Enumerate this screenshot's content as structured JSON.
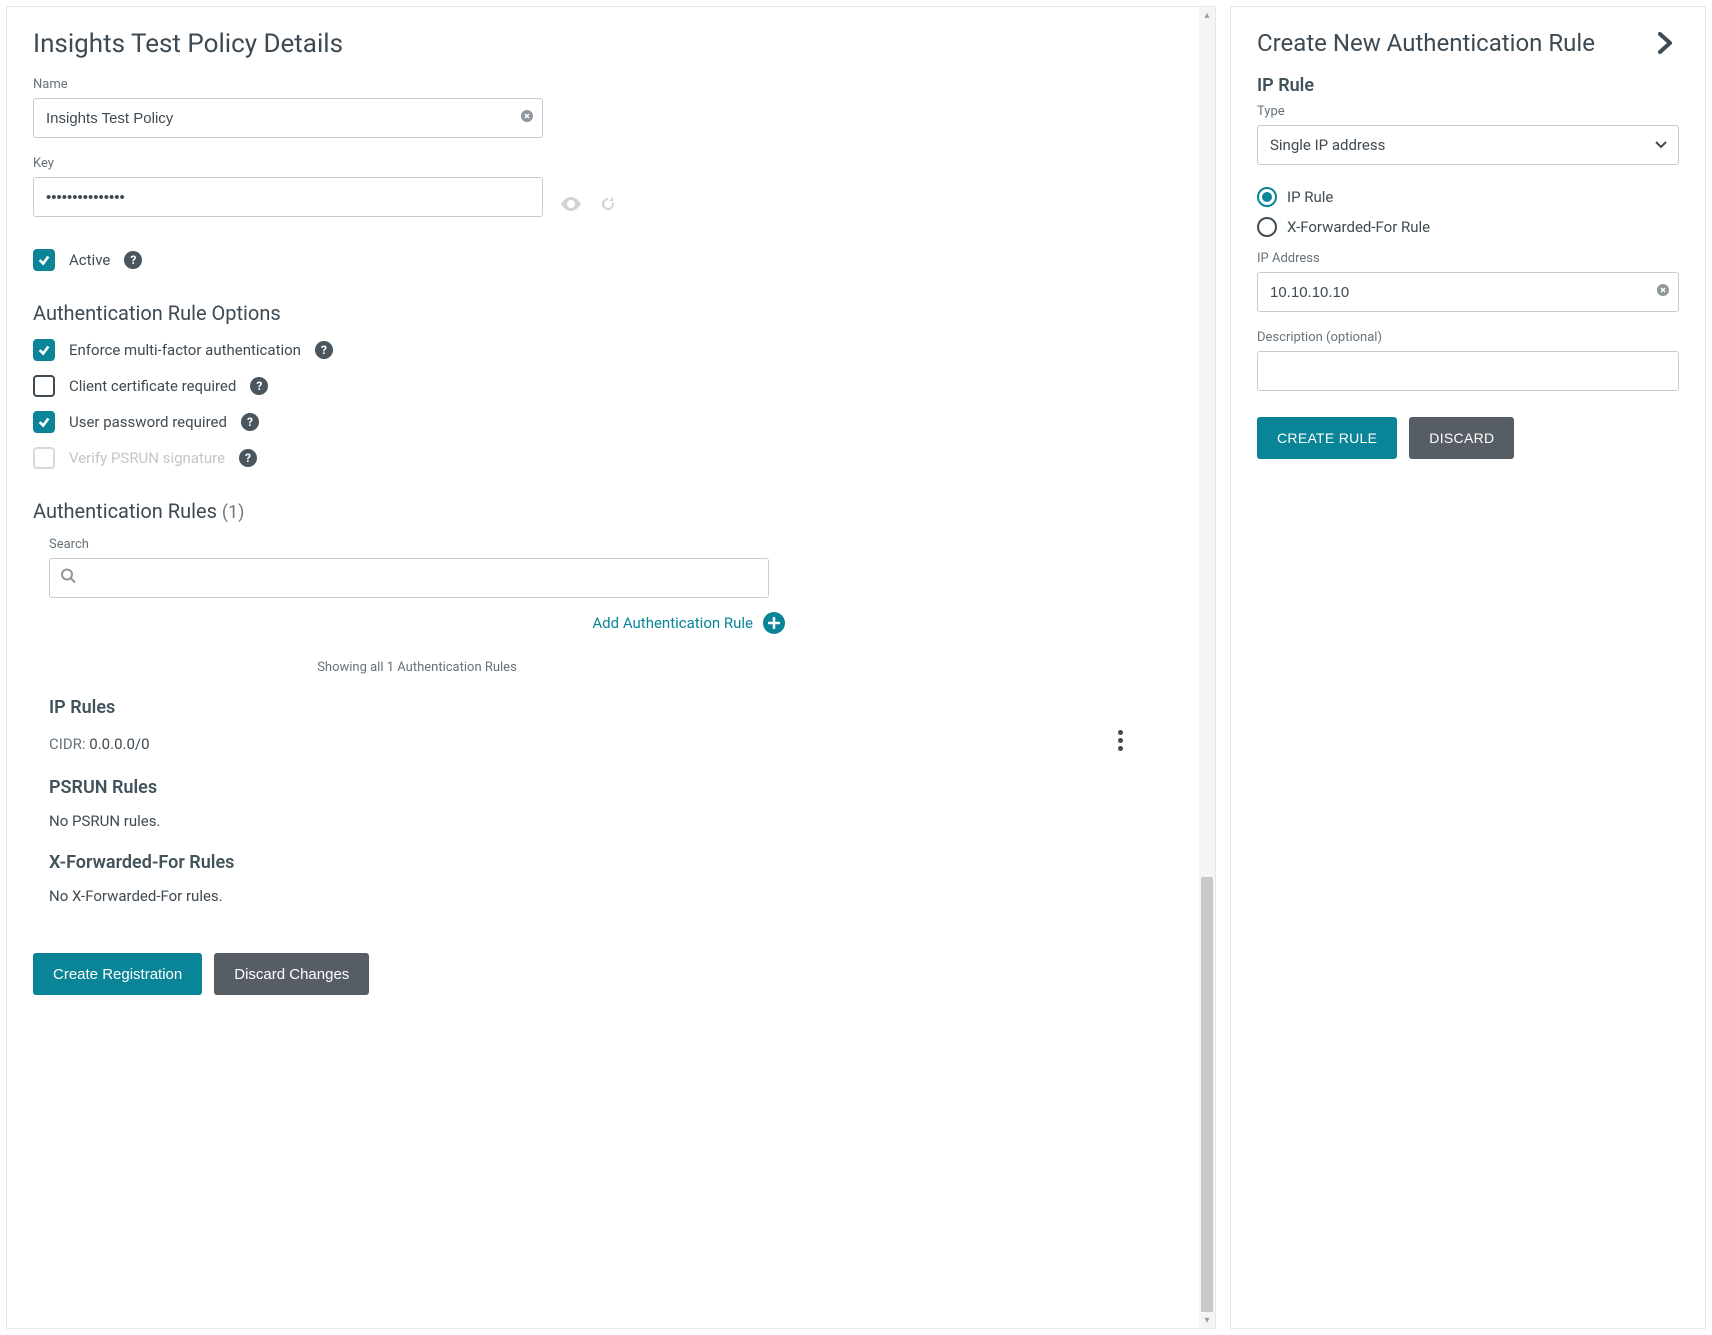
{
  "leftPanel": {
    "title": "Insights Test Policy Details",
    "name": {
      "label": "Name",
      "value": "Insights Test Policy"
    },
    "key": {
      "label": "Key",
      "value": "•••••••••••••••"
    },
    "active": {
      "label": "Active",
      "checked": true
    },
    "authOptions": {
      "title": "Authentication Rule Options",
      "items": [
        {
          "label": "Enforce multi-factor authentication",
          "checked": true,
          "disabled": false
        },
        {
          "label": "Client certificate required",
          "checked": false,
          "disabled": false
        },
        {
          "label": "User password required",
          "checked": true,
          "disabled": false
        },
        {
          "label": "Verify PSRUN signature",
          "checked": false,
          "disabled": true
        }
      ]
    },
    "authRules": {
      "title": "Authentication Rules",
      "count": "(1)",
      "searchLabel": "Search",
      "searchValue": "",
      "addLink": "Add Authentication Rule",
      "showingText": "Showing all 1 Authentication Rules",
      "ipRules": {
        "title": "IP Rules",
        "cidrLabel": "CIDR:",
        "cidrValue": "0.0.0.0/0"
      },
      "psrunRules": {
        "title": "PSRUN Rules",
        "emptyText": "No PSRUN rules."
      },
      "xffRules": {
        "title": "X-Forwarded-For Rules",
        "emptyText": "No X-Forwarded-For rules."
      }
    },
    "buttons": {
      "create": "Create Registration",
      "discard": "Discard Changes"
    }
  },
  "rightPanel": {
    "title": "Create New Authentication Rule",
    "subtitle": "IP Rule",
    "type": {
      "label": "Type",
      "value": "Single IP address"
    },
    "radios": [
      {
        "label": "IP Rule",
        "selected": true
      },
      {
        "label": "X-Forwarded-For Rule",
        "selected": false
      }
    ],
    "ipAddress": {
      "label": "IP Address",
      "value": "10.10.10.10"
    },
    "description": {
      "label": "Description (optional)",
      "value": ""
    },
    "buttons": {
      "create": "CREATE RULE",
      "discard": "DISCARD"
    }
  }
}
